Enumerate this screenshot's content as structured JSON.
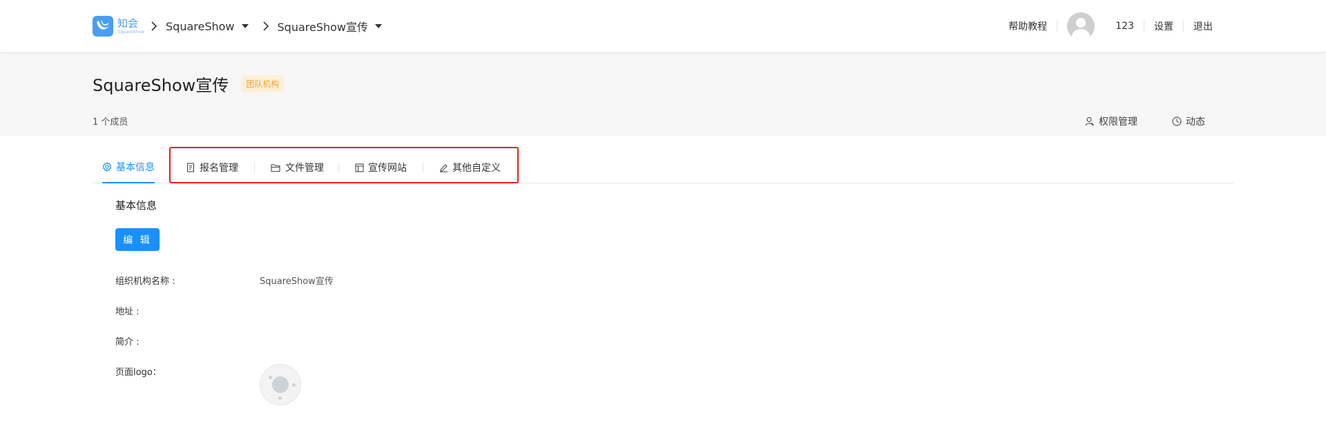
{
  "header": {
    "logo": {
      "cn": "知会",
      "en": "SquareShow"
    },
    "breadcrumbs": [
      {
        "label": "SquareShow"
      },
      {
        "label": "SquareShow宣传"
      }
    ],
    "right": {
      "help": "帮助教程",
      "username": "123",
      "settings": "设置",
      "logout": "退出"
    }
  },
  "org": {
    "title": "SquareShow宣传",
    "tag": "团队机构",
    "members": "1 个成员",
    "actions": [
      {
        "label": "权限管理",
        "icon": "user-permission-icon"
      },
      {
        "label": "动态",
        "icon": "clock-icon"
      }
    ]
  },
  "tabs": [
    {
      "label": "基本信息",
      "icon": "gear-icon",
      "active": true
    },
    {
      "label": "报名管理",
      "icon": "form-icon"
    },
    {
      "label": "文件管理",
      "icon": "folder-icon"
    },
    {
      "label": "宣传网站",
      "icon": "layout-icon"
    },
    {
      "label": "其他自定义",
      "icon": "pen-icon"
    }
  ],
  "content": {
    "section_title": "基本信息",
    "edit_label": "编 辑",
    "fields": [
      {
        "label": "组织机构名称 :",
        "value": "SquareShow宣传"
      },
      {
        "label": "地址 :",
        "value": ""
      },
      {
        "label": "简介 :",
        "value": ""
      },
      {
        "label": "页面logo：",
        "value": ""
      }
    ]
  },
  "colors": {
    "accent": "#1890ff",
    "tag_text": "#f0a325",
    "tag_bg": "#fdf0d9",
    "highlight": "#e81c1c"
  }
}
